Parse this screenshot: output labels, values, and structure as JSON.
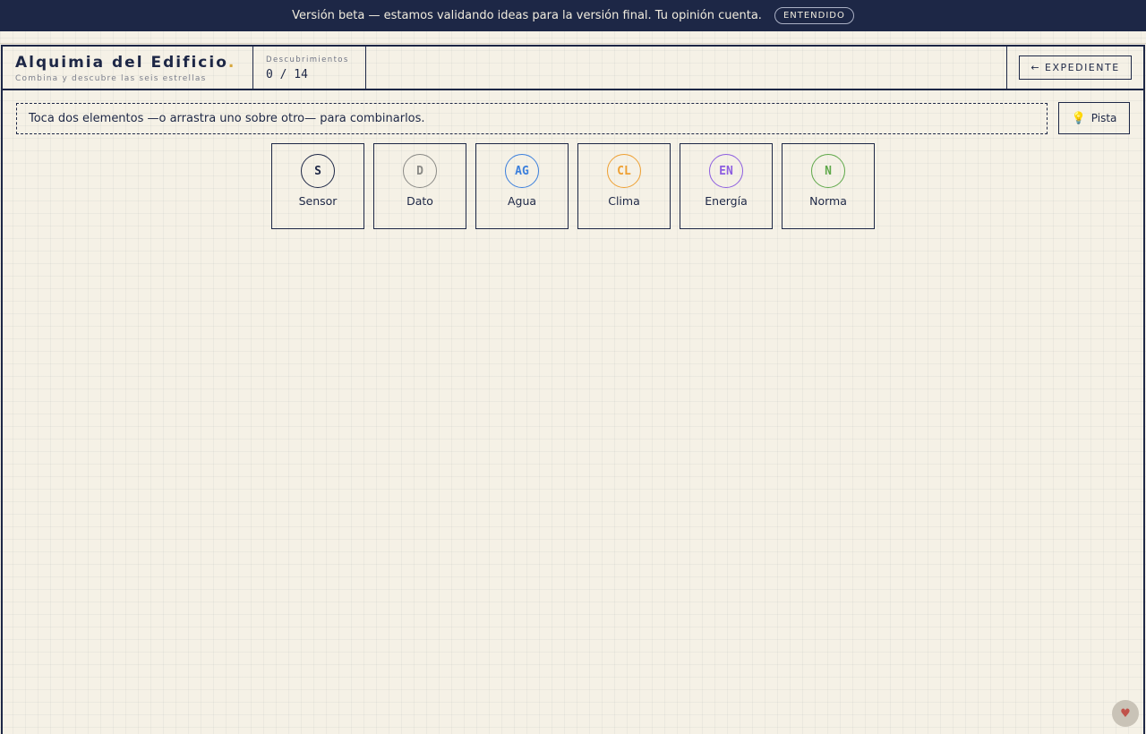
{
  "banner": {
    "message": "Versión beta — estamos validando ideas para la versión final. Tu opinión cuenta.",
    "button_label": "ENTENDIDO"
  },
  "header": {
    "title": "Alquimia del Edificio",
    "title_dot": ".",
    "subtitle": "Combina y descubre las seis estrellas",
    "counter_label": "Descubrimientos",
    "counter_value": "0 / 14",
    "back_button_label": "← EXPEDIENTE"
  },
  "instructions": {
    "text": "Toca dos elementos —o arrastra uno sobre otro— para combinarlos.",
    "hint_button_label": "Pista",
    "hint_icon": "lightbulb-icon"
  },
  "elements": [
    {
      "symbol": "S",
      "name": "Sensor",
      "color": "#1d2746"
    },
    {
      "symbol": "D",
      "name": "Dato",
      "color": "#8a8a86"
    },
    {
      "symbol": "AG",
      "name": "Agua",
      "color": "#3b7fdc"
    },
    {
      "symbol": "CL",
      "name": "Clima",
      "color": "#eea033"
    },
    {
      "symbol": "EN",
      "name": "Energía",
      "color": "#8d5ee0"
    },
    {
      "symbol": "N",
      "name": "Norma",
      "color": "#5fa84a"
    }
  ],
  "colors": {
    "navy": "#1d2746",
    "paper": "#f5f1e6",
    "accent_dot": "#d7a63b"
  },
  "corner_widget_icon": "mascot-icon"
}
